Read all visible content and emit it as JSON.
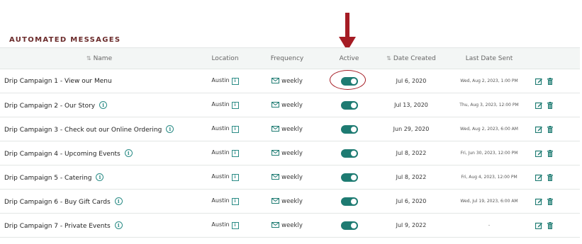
{
  "section_title": "AUTOMATED MESSAGES",
  "colors": {
    "accent": "#1e7b72",
    "title": "#6b2b2b",
    "annotation": "#a51c24"
  },
  "headers": {
    "name": "Name",
    "location": "Location",
    "frequency": "Frequency",
    "active": "Active",
    "date_created": "Date Created",
    "last_date_sent": "Last Date Sent"
  },
  "rows": [
    {
      "name": "Drip Campaign 1 - View our Menu",
      "location": "Austin",
      "frequency": "weekly",
      "active": true,
      "date_created": "Jul 6, 2020",
      "last_sent": "Wed, Aug 2, 2023, 1:00 PM"
    },
    {
      "name": "Drip Campaign 2 - Our Story",
      "location": "Austin",
      "frequency": "weekly",
      "active": true,
      "date_created": "Jul 13, 2020",
      "last_sent": "Thu, Aug 3, 2023, 12:00 PM"
    },
    {
      "name": "Drip Campaign 3 - Check out our Online Ordering",
      "location": "Austin",
      "frequency": "weekly",
      "active": true,
      "date_created": "Jun 29, 2020",
      "last_sent": "Wed, Aug 2, 2023, 6:00 AM"
    },
    {
      "name": "Drip Campaign 4 - Upcoming Events",
      "location": "Austin",
      "frequency": "weekly",
      "active": true,
      "date_created": "Jul 8, 2022",
      "last_sent": "Fri, Jun 30, 2023, 12:00 PM"
    },
    {
      "name": "Drip Campaign 5 - Catering",
      "location": "Austin",
      "frequency": "weekly",
      "active": true,
      "date_created": "Jul 8, 2022",
      "last_sent": "Fri, Aug 4, 2023, 12:00 PM"
    },
    {
      "name": "Drip Campaign 6 - Buy Gift Cards",
      "location": "Austin",
      "frequency": "weekly",
      "active": true,
      "date_created": "Jul 6, 2020",
      "last_sent": "Wed, Jul 19, 2023, 6:00 AM"
    },
    {
      "name": "Drip Campaign 7 - Private Events",
      "location": "Austin",
      "frequency": "weekly",
      "active": true,
      "date_created": "Jul 9, 2022",
      "last_sent": "-"
    }
  ],
  "icons": {
    "name_info": "info-circle-icon",
    "location": "location-info-icon",
    "frequency": "envelope-icon",
    "edit": "edit-icon",
    "delete": "trash-icon",
    "sort": "sort-icon",
    "annotation": "down-arrow-icon"
  }
}
